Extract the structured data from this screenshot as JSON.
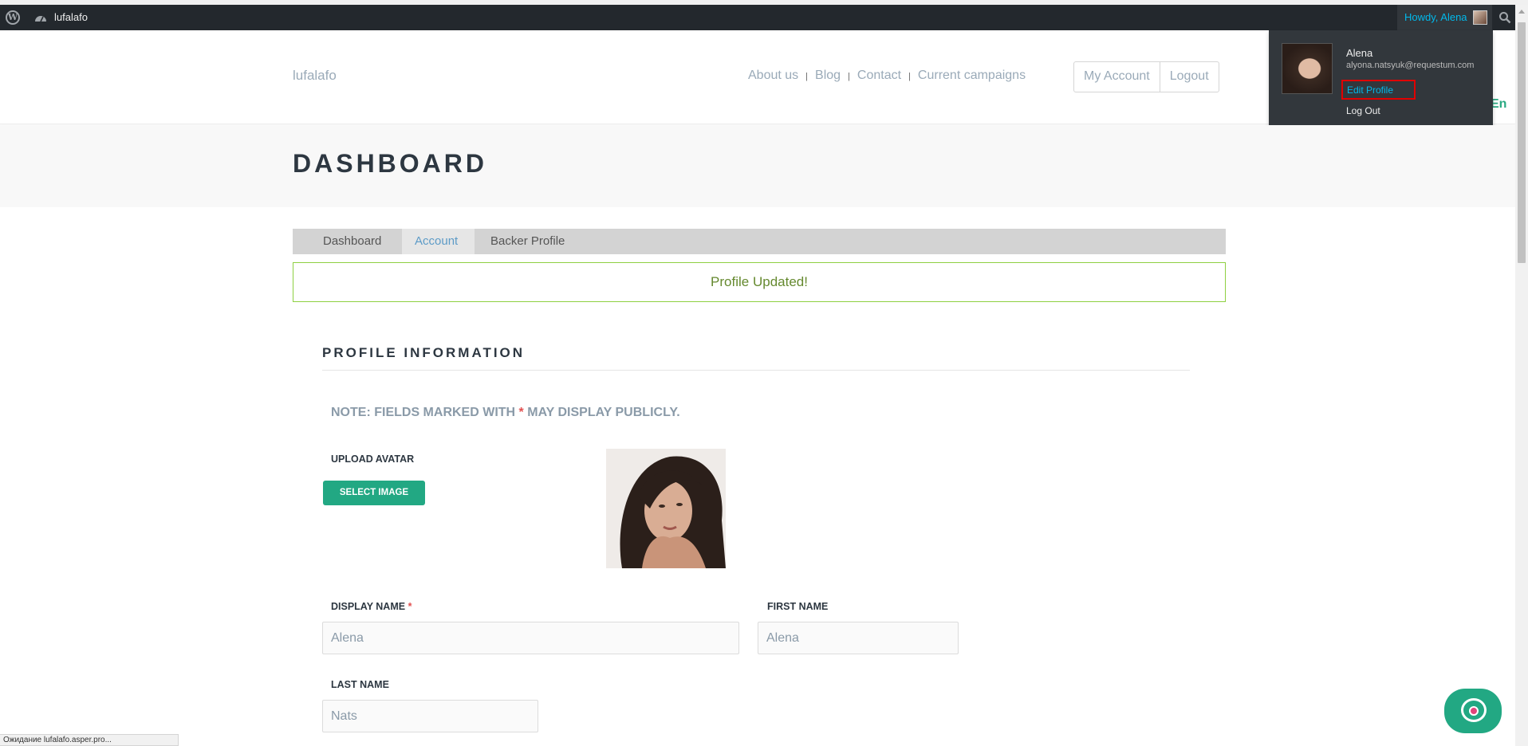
{
  "adminbar": {
    "site_name": "lufalafo",
    "howdy": "Howdy, Alena",
    "user_menu": {
      "name": "Alena",
      "email": "alyona.natsyuk@requestum.com",
      "edit_profile": "Edit Profile",
      "log_out": "Log Out"
    }
  },
  "header": {
    "brand": "lufalafo",
    "nav": [
      "About us",
      "Blog",
      "Contact",
      "Current campaigns"
    ],
    "nav_separator": "|",
    "my_account": "My Account",
    "logout": "Logout",
    "language": "En"
  },
  "hero": {
    "title": "DASHBOARD"
  },
  "tabs": [
    "Dashboard",
    "Account",
    "Backer Profile"
  ],
  "active_tab": "Account",
  "notice": "Profile Updated!",
  "profile": {
    "title": "PROFILE INFORMATION",
    "note_prefix": "NOTE: FIELDS MARKED WITH",
    "note_star": "*",
    "note_suffix": "MAY DISPLAY PUBLICLY.",
    "upload_avatar_label": "UPLOAD AVATAR",
    "select_image": "SELECT IMAGE",
    "display_name_label": "DISPLAY NAME",
    "required_star": "*",
    "display_name_value": "Alena",
    "first_name_label": "FIRST NAME",
    "first_name_value": "Alena",
    "last_name_label": "LAST NAME",
    "last_name_value": "Nats"
  },
  "statusbar": "Ожидание lufalafo.asper.pro...",
  "colors": {
    "adminbar": "#23282d",
    "accent_green": "#22a883",
    "link_blue": "#00b9eb",
    "notice_border": "#8ed041",
    "highlight_red": "#e10000"
  },
  "icons": [
    "wordpress-logo-icon",
    "dashboard-gauge-icon",
    "search-icon",
    "chat-icon"
  ]
}
